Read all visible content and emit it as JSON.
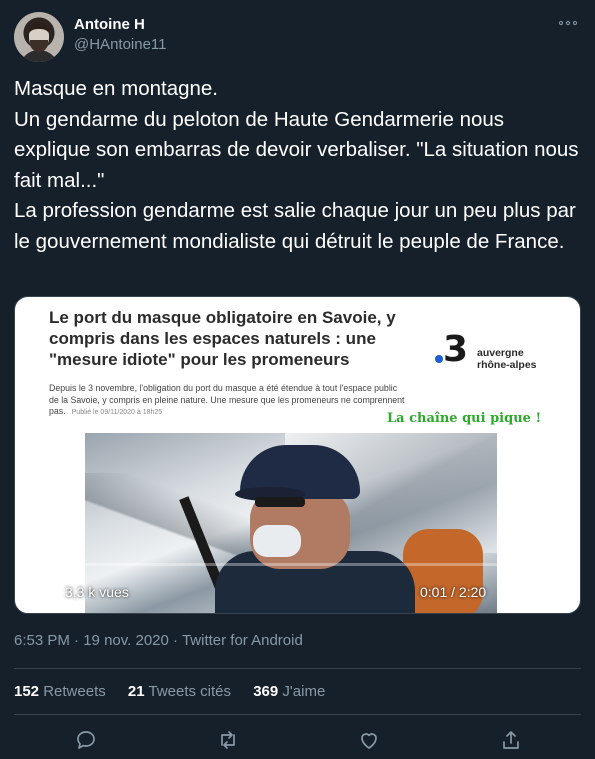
{
  "author": {
    "name": "Antoine H",
    "handle": "@HAntoine11"
  },
  "tweet": {
    "text": "Masque en montagne.\nUn gendarme du peloton de Haute Gendarmerie nous explique son embarras de devoir verbaliser. \"La situation nous fait mal...\"\nLa profession gendarme est salie chaque jour un peu plus par le gouvernement mondialiste qui détruit le peuple de France."
  },
  "media": {
    "headline": "Le port du masque obligatoire en Savoie, y compris dans les espaces naturels : une \"mesure idiote\" pour les promeneurs",
    "channel_number": "3",
    "channel_region_line1": "auvergne",
    "channel_region_line2": "rhône-alpes",
    "description": "Depuis le 3 novembre, l'obligation du port du masque a été étendue à tout l'espace public de la Savoie, y compris en pleine nature. Une mesure que les promeneurs ne comprennent pas.",
    "published": "Publié le 09/11/2020 à 18h25",
    "tagline": "La chaîne qui pique !",
    "views": "3,3 k vues",
    "time": "0:01 / 2:20",
    "progress": 0.008
  },
  "meta": {
    "time": "6:53 PM",
    "separator1": "·",
    "date": "19 nov. 2020",
    "separator2": "·",
    "source": "Twitter for Android"
  },
  "stats": {
    "retweets_count": "152",
    "retweets_label": "Retweets",
    "quotes_count": "21",
    "quotes_label": "Tweets cités",
    "likes_count": "369",
    "likes_label": "J'aime"
  },
  "colors": {
    "background": "#15202b",
    "secondary_text": "#8899a6",
    "divider": "#38444d",
    "tagline_green": "#2da82d"
  },
  "icons": [
    "more-icon",
    "play-icon",
    "volume-icon",
    "fullscreen-icon",
    "reply-icon",
    "retweet-icon",
    "like-icon",
    "share-icon"
  ]
}
